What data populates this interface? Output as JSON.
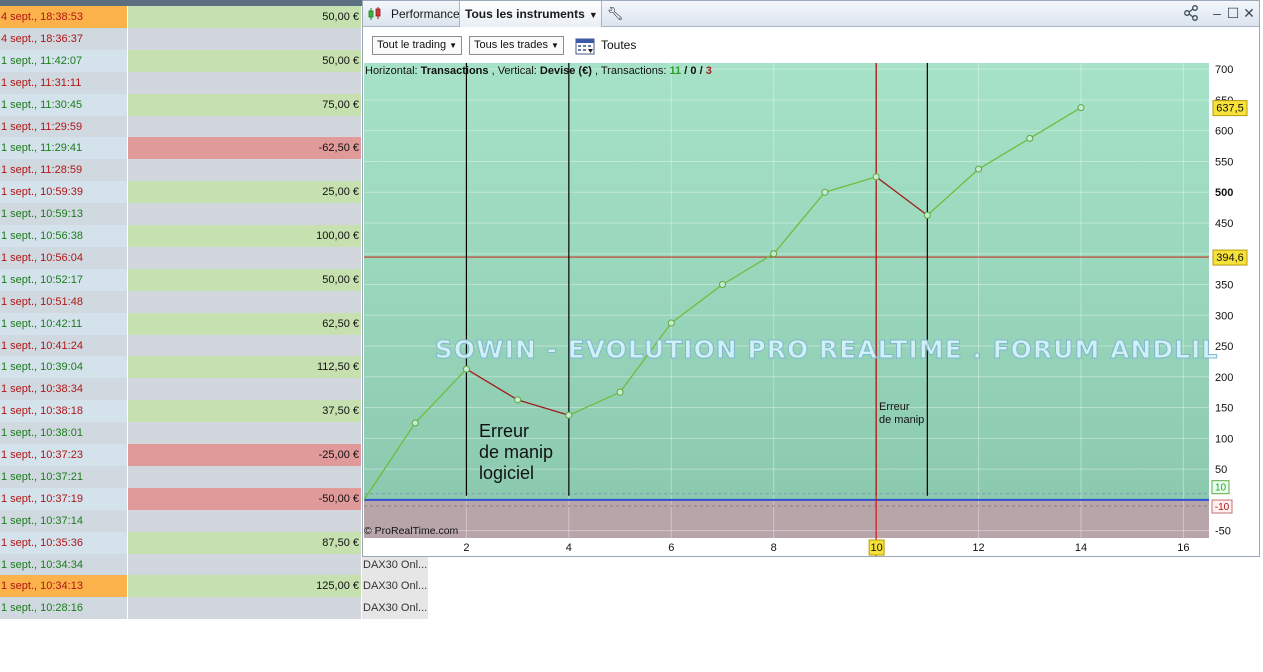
{
  "trades": [
    {
      "date": "4 sept., 18:38:53",
      "date_color": "red",
      "highlight": true,
      "gain": "50,00 €",
      "gain_kind": "pos"
    },
    {
      "date": "4 sept., 18:36:37",
      "date_color": "red",
      "highlight": false,
      "gain": "",
      "gain_kind": "empty"
    },
    {
      "date": "1 sept., 11:42:07",
      "date_color": "green",
      "highlight": false,
      "gain": "50,00 €",
      "gain_kind": "pos"
    },
    {
      "date": "1 sept., 11:31:11",
      "date_color": "red",
      "highlight": false,
      "gain": "",
      "gain_kind": "empty"
    },
    {
      "date": "1 sept., 11:30:45",
      "date_color": "green",
      "highlight": false,
      "gain": "75,00 €",
      "gain_kind": "pos"
    },
    {
      "date": "1 sept., 11:29:59",
      "date_color": "red",
      "highlight": false,
      "gain": "",
      "gain_kind": "empty"
    },
    {
      "date": "1 sept., 11:29:41",
      "date_color": "green",
      "highlight": false,
      "gain": "-62,50 €",
      "gain_kind": "neg"
    },
    {
      "date": "1 sept., 11:28:59",
      "date_color": "red",
      "highlight": false,
      "gain": "",
      "gain_kind": "empty"
    },
    {
      "date": "1 sept., 10:59:39",
      "date_color": "red",
      "highlight": false,
      "gain": "25,00 €",
      "gain_kind": "pos"
    },
    {
      "date": "1 sept., 10:59:13",
      "date_color": "green",
      "highlight": false,
      "gain": "",
      "gain_kind": "empty"
    },
    {
      "date": "1 sept., 10:56:38",
      "date_color": "green",
      "highlight": false,
      "gain": "100,00 €",
      "gain_kind": "pos"
    },
    {
      "date": "1 sept., 10:56:04",
      "date_color": "red",
      "highlight": false,
      "gain": "",
      "gain_kind": "empty"
    },
    {
      "date": "1 sept., 10:52:17",
      "date_color": "green",
      "highlight": false,
      "gain": "50,00 €",
      "gain_kind": "pos"
    },
    {
      "date": "1 sept., 10:51:48",
      "date_color": "red",
      "highlight": false,
      "gain": "",
      "gain_kind": "empty"
    },
    {
      "date": "1 sept., 10:42:11",
      "date_color": "green",
      "highlight": false,
      "gain": "62,50 €",
      "gain_kind": "pos"
    },
    {
      "date": "1 sept., 10:41:24",
      "date_color": "red",
      "highlight": false,
      "gain": "",
      "gain_kind": "empty"
    },
    {
      "date": "1 sept., 10:39:04",
      "date_color": "green",
      "highlight": false,
      "gain": "112,50 €",
      "gain_kind": "pos"
    },
    {
      "date": "1 sept., 10:38:34",
      "date_color": "red",
      "highlight": false,
      "gain": "",
      "gain_kind": "empty"
    },
    {
      "date": "1 sept., 10:38:18",
      "date_color": "red",
      "highlight": false,
      "gain": "37,50 €",
      "gain_kind": "pos"
    },
    {
      "date": "1 sept., 10:38:01",
      "date_color": "green",
      "highlight": false,
      "gain": "",
      "gain_kind": "empty"
    },
    {
      "date": "1 sept., 10:37:23",
      "date_color": "red",
      "highlight": false,
      "gain": "-25,00 €",
      "gain_kind": "neg"
    },
    {
      "date": "1 sept., 10:37:21",
      "date_color": "green",
      "highlight": false,
      "gain": "",
      "gain_kind": "empty"
    },
    {
      "date": "1 sept., 10:37:19",
      "date_color": "red",
      "highlight": false,
      "gain": "-50,00 €",
      "gain_kind": "neg"
    },
    {
      "date": "1 sept., 10:37:14",
      "date_color": "green",
      "highlight": false,
      "gain": "",
      "gain_kind": "empty"
    },
    {
      "date": "1 sept., 10:35:36",
      "date_color": "red",
      "highlight": false,
      "gain": "87,50 €",
      "gain_kind": "pos"
    },
    {
      "date": "1 sept., 10:34:34",
      "date_color": "green",
      "highlight": false,
      "gain": "",
      "gain_kind": "empty",
      "instrument": "DAX30 Onl..."
    },
    {
      "date": "1 sept., 10:34:13",
      "date_color": "red",
      "highlight": true,
      "gain": "125,00 €",
      "gain_kind": "pos",
      "instrument": "DAX30 Onl..."
    },
    {
      "date": "1 sept., 10:28:16",
      "date_color": "green",
      "highlight": false,
      "gain": "",
      "gain_kind": "empty",
      "instrument": "DAX30 Onl..."
    }
  ],
  "window": {
    "tab_performance": "Performance",
    "tab_instruments": "Tous les instruments",
    "dropdown_trading": "Tout le trading",
    "dropdown_trades": "Tous les trades",
    "filter_label": "Toutes"
  },
  "colors": {
    "chart_bg_top": "#a6e2c8",
    "chart_bg_bottom": "#8ccab0",
    "negative_zone": "#b7a5aa",
    "equity_up": "#6abf3c",
    "equity_down": "#a11c1c",
    "level_line": "#c0392b",
    "zero_band": "#2d4fd6",
    "badge_yellow": "#f7e23a"
  },
  "chart_data": {
    "type": "line",
    "info": {
      "horizontal_label": "Horizontal:",
      "horizontal_value": "Transactions",
      "vertical_label": "Vertical:",
      "vertical_value": "Devise (€)",
      "transactions_label": "Transactions:",
      "wins": "11",
      "sep1": "/",
      "neutral": "0",
      "sep2": "/",
      "losses": "3"
    },
    "x": [
      0,
      1,
      2,
      3,
      4,
      5,
      6,
      7,
      8,
      9,
      10,
      11,
      12,
      13,
      14
    ],
    "y": [
      0,
      125,
      212.5,
      162.5,
      137.5,
      175,
      287.5,
      350,
      400,
      500,
      525,
      462.5,
      537.5,
      587.5,
      637.5
    ],
    "xlim": [
      0,
      16.5
    ],
    "ylim": [
      -62,
      710
    ],
    "x_ticks": [
      2,
      4,
      6,
      8,
      10,
      12,
      14,
      16
    ],
    "y_ticks": [
      -50,
      50,
      100,
      150,
      200,
      250,
      300,
      350,
      400,
      450,
      500,
      550,
      600,
      650,
      700
    ],
    "y_bold_tick": 500,
    "last_value_badge": {
      "value": 637.5,
      "label": "637,5"
    },
    "level_line": {
      "value": 394.6,
      "label": "394,6"
    },
    "band": {
      "upper": 10,
      "lower": -10,
      "upper_label": "10",
      "lower_label": "-10"
    },
    "cursor": {
      "x": 10,
      "label": "10"
    },
    "vertical_markers": [
      2,
      4,
      10,
      11
    ],
    "watermark": "SOWIN - EVOLUTION PRO REALTIME . FORUM ANDLIL",
    "annotation_large": [
      "Erreur",
      "de manip",
      "logiciel"
    ],
    "annotation_small": [
      "Erreur",
      "de manip"
    ],
    "copyright": "© ProRealTime.com",
    "grid": true
  }
}
